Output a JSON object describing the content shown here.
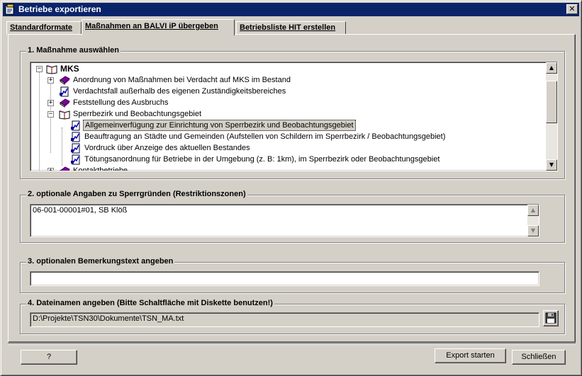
{
  "window": {
    "title": "Betriebe exportieren",
    "close_glyph": "✕"
  },
  "tabs": [
    {
      "label": "Standardformate"
    },
    {
      "label": "Maßnahmen an BALVI iP übergeben"
    },
    {
      "label": "Betriebsliste HIT erstellen"
    }
  ],
  "section1": {
    "legend": "1. Maßnahme auswählen",
    "tree": [
      {
        "label": "MKS",
        "expander": "−"
      },
      {
        "label": "Anordnung von Maßnahmen bei Verdacht auf MKS im Bestand",
        "expander": "+"
      },
      {
        "label": "Verdachtsfall außerhalb des eigenen Zuständigkeitsbereiches"
      },
      {
        "label": "Feststellung des Ausbruchs",
        "expander": "+"
      },
      {
        "label": "Sperrbezirk und Beobachtungsgebiet",
        "expander": "−"
      },
      {
        "label": "Allgemeinverfügung zur Einrichtung von Sperrbezirk und Beobachtungsgebiet",
        "selected": true
      },
      {
        "label": "Beauftragung an Städte und Gemeinden (Aufstellen von Schildern im Sperrbezirk / Beobachtungsgebiet)"
      },
      {
        "label": "Vordruck über Anzeige des aktuellen Bestandes"
      },
      {
        "label": "Tötungsanordnung für Betriebe in der Umgebung (z. B: 1km), im Sperrbezirk oder Beobachtungsgebiet"
      },
      {
        "label": "Kontaktbetriebe",
        "expander": "+"
      }
    ],
    "scroll_up": "▲",
    "scroll_down": "▼"
  },
  "section2": {
    "legend": "2. optionale Angaben zu Sperrgründen (Restriktionszonen)",
    "value": "06-001-00001#01, SB Klöß"
  },
  "section3": {
    "legend": "3. optionalen Bemerkungstext angeben",
    "value": ""
  },
  "section4": {
    "legend": "4. Dateinamen angeben (Bitte Schaltfläche mit Diskette benutzen!)",
    "value": "D:\\Projekte\\TSN30\\Dokumente\\TSN_MA.txt",
    "save_icon": "floppy-disk-icon"
  },
  "buttons": {
    "help": "?",
    "export": "Export starten",
    "close": "Schließen"
  }
}
